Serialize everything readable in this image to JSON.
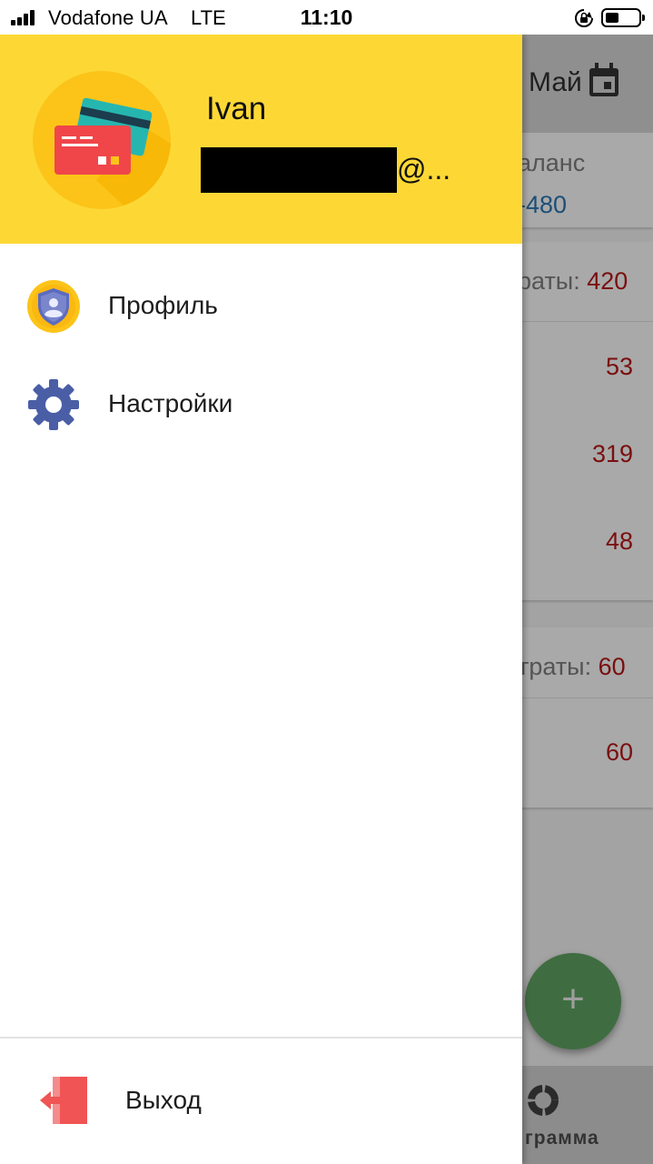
{
  "status_bar": {
    "carrier": "Vodafone UA",
    "network": "LTE",
    "time": "11:10"
  },
  "background": {
    "month": "Май",
    "balance_label": "аланс",
    "balance_value": "-480",
    "group1_label": "раты: ",
    "group1_total": "420",
    "rows": [
      "53",
      "319",
      "48"
    ],
    "group2_label": "траты: ",
    "group2_total": "60",
    "group2_rows": [
      "60"
    ],
    "fab_symbol": "+",
    "bottom_nav_label": "грамма"
  },
  "drawer": {
    "user_name": "Ivan",
    "email_suffix": "@...",
    "menu": [
      {
        "label": "Профиль",
        "icon": "profile-shield-icon"
      },
      {
        "label": "Настройки",
        "icon": "gear-icon"
      }
    ],
    "logout_label": "Выход",
    "logout_icon": "exit-door-icon"
  },
  "colors": {
    "header_yellow": "#fdd835",
    "logout_red": "#f05454",
    "gear_blue": "#4a5ea6"
  }
}
